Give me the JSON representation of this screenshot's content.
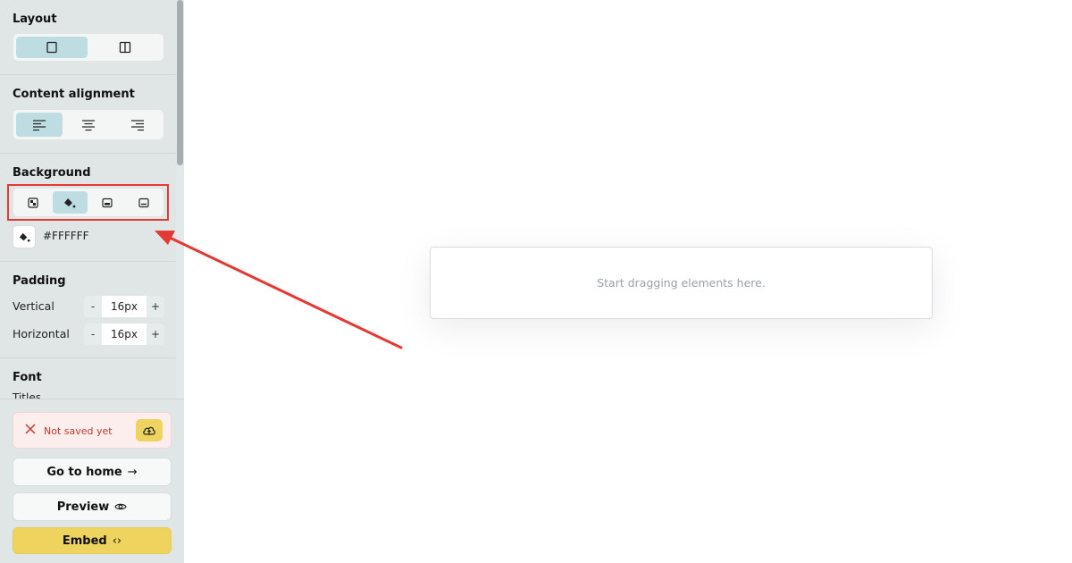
{
  "sidebar": {
    "layout": {
      "title": "Layout",
      "options": [
        "single-column-icon",
        "two-column-icon"
      ],
      "selected": 0
    },
    "alignment": {
      "title": "Content alignment",
      "options": [
        "align-left-icon",
        "align-center-icon",
        "align-right-icon"
      ],
      "selected": 0
    },
    "background": {
      "title": "Background",
      "options": [
        "checker-icon",
        "paint-bucket-icon",
        "image-icon",
        "image-fill-icon"
      ],
      "selected": 1,
      "color_value": "#FFFFFF"
    },
    "padding": {
      "title": "Padding",
      "vertical": {
        "label": "Vertical",
        "value": "16px",
        "minus": "-",
        "plus": "+"
      },
      "horizontal": {
        "label": "Horizontal",
        "value": "16px",
        "minus": "-",
        "plus": "+"
      }
    },
    "font": {
      "title": "Font",
      "sub_label": "Titles"
    }
  },
  "status": {
    "text": "Not saved yet"
  },
  "actions": {
    "go_home": "Go to home",
    "go_home_icon": "→",
    "preview": "Preview",
    "embed": "Embed",
    "embed_icon": "‹›"
  },
  "canvas": {
    "placeholder": "Start dragging elements here."
  },
  "colors": {
    "sidebar_bg": "#dfe6e5",
    "active_seg": "#bddde3",
    "accent_yellow": "#eed45e",
    "highlight_red": "#e53935"
  }
}
